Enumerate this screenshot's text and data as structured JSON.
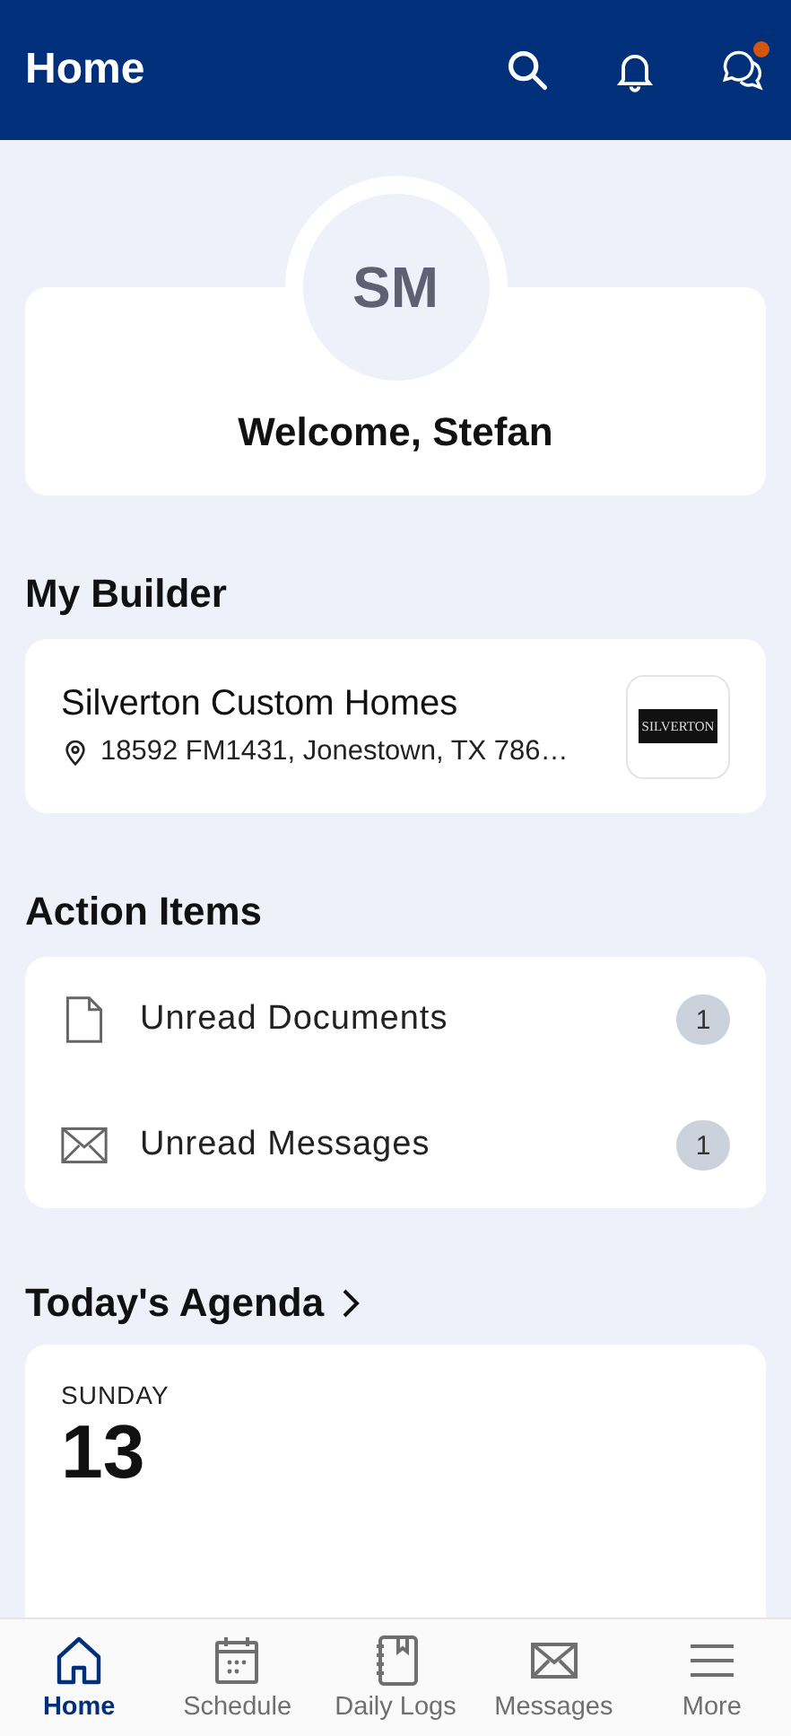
{
  "header": {
    "title": "Home",
    "notification_dot": true
  },
  "profile": {
    "initials": "SM",
    "welcome": "Welcome, Stefan"
  },
  "my_builder": {
    "heading": "My Builder",
    "name": "Silverton Custom Homes",
    "address": "18592 FM1431, Jonestown, TX 786…",
    "logo_text": "SILVERTON"
  },
  "action_items": {
    "heading": "Action Items",
    "items": [
      {
        "kind": "document",
        "label": "Unread Documents",
        "count": "1"
      },
      {
        "kind": "message",
        "label": "Unread Messages",
        "count": "1"
      }
    ]
  },
  "agenda": {
    "heading": "Today's Agenda",
    "weekday": "SUNDAY",
    "day": "13"
  },
  "bottom_nav": [
    {
      "kind": "home",
      "label": "Home",
      "selected": true
    },
    {
      "kind": "schedule",
      "label": "Schedule",
      "selected": false
    },
    {
      "kind": "logs",
      "label": "Daily Logs",
      "selected": false
    },
    {
      "kind": "messages",
      "label": "Messages",
      "selected": false
    },
    {
      "kind": "more",
      "label": "More",
      "selected": false
    }
  ]
}
